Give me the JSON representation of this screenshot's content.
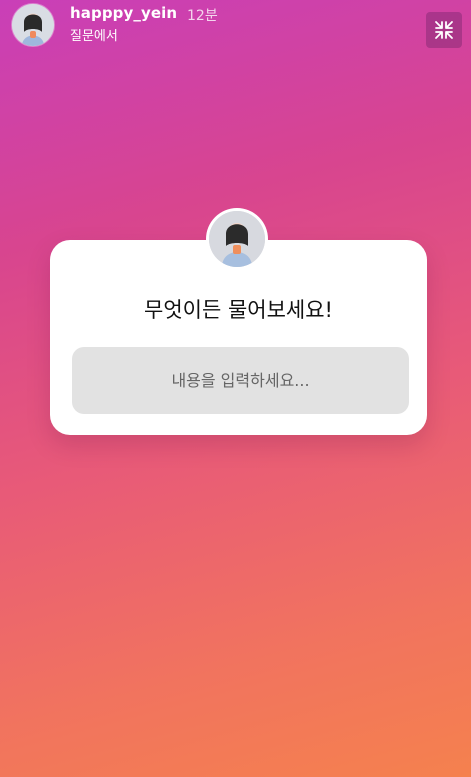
{
  "story": {
    "username": "happpy_yein",
    "timestamp": "12분",
    "subtitle": "질문에서",
    "avatar_icon": "profile-photo",
    "close_icon": "collapse-arrows-icon"
  },
  "question_sticker": {
    "title": "무엇이든 물어보세요!",
    "placeholder": "내용을 입력하세요...",
    "avatar_icon": "profile-photo"
  },
  "colors": {
    "gradient_start": "#c93fb8",
    "gradient_end": "#f5814e",
    "card": "#ffffff",
    "field": "#e2e2e2"
  }
}
